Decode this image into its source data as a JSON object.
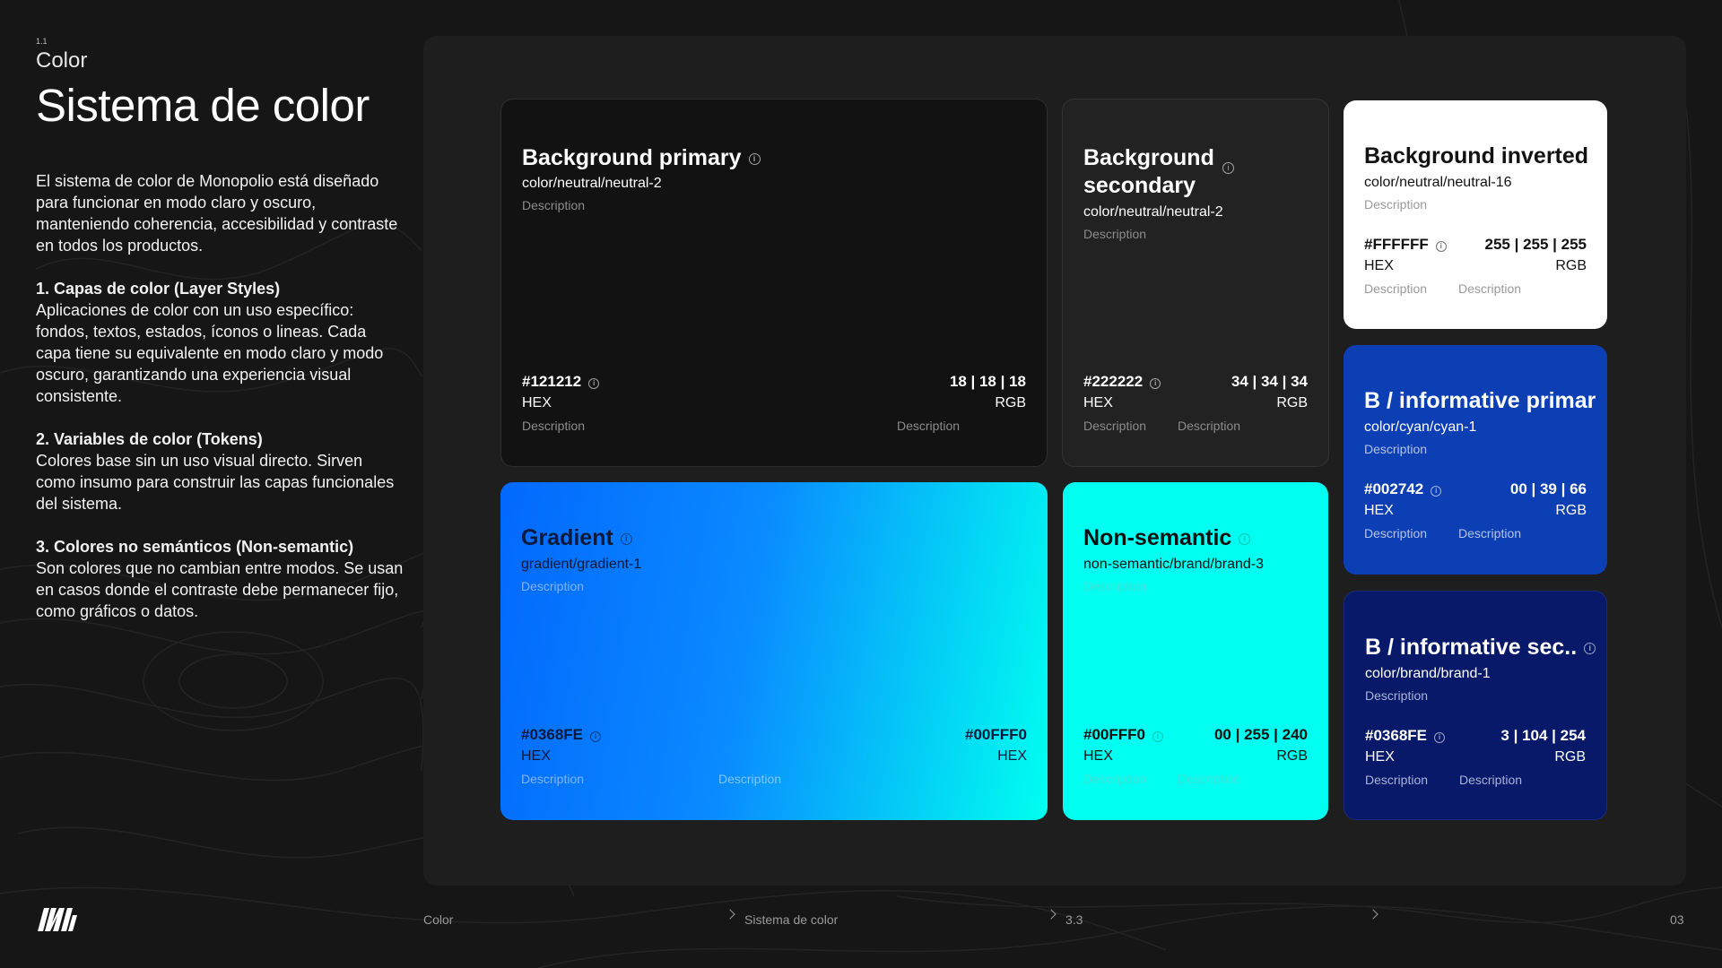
{
  "header": {
    "section_number": "1.1",
    "section_label": "Color",
    "title": "Sistema de color"
  },
  "intro": {
    "paragraph": "El sistema de color de Monopolio está diseñado para funcionar en modo claro y oscuro, manteniendo coherencia, accesibilidad y contraste en todos los productos.",
    "items": [
      {
        "heading": "1. Capas de color (Layer Styles)",
        "text": "Aplicaciones de color con un uso específico: fondos, textos, estados, íconos o lineas. Cada capa tiene su equivalente en modo claro y modo oscuro, garantizando una experiencia visual consistente."
      },
      {
        "heading": "2. Variables de color (Tokens)",
        "text": "Colores base sin un uso visual directo. Sirven como insumo para construir las capas funcionales del sistema."
      },
      {
        "heading": "3. Colores no semánticos (Non-semantic)",
        "text": "Son colores que no cambian entre modos. Se usan en casos donde el contraste debe permanecer fijo, como gráficos o datos."
      }
    ]
  },
  "cards": {
    "primary": {
      "title": "Background  primary",
      "token": "color/neutral/neutral-2",
      "description": "Description",
      "hex": "#121212",
      "rgb": "18 | 18 | 18",
      "hex_label": "HEX",
      "rgb_label": "RGB",
      "desc_left": "Description",
      "desc_right": "Description",
      "color": "#121212"
    },
    "secondary": {
      "title_line1": "Background",
      "title_line2": "secondary",
      "token": "color/neutral/neutral-2",
      "description": "Description",
      "hex": "#222222",
      "rgb": "34 | 34 | 34",
      "hex_label": "HEX",
      "rgb_label": "RGB",
      "desc_left": "Description",
      "desc_right": "Description",
      "color": "#222222"
    },
    "inverted": {
      "title": "Background  inverted",
      "token": "color/neutral/neutral-16",
      "description": "Description",
      "hex": "#FFFFFF",
      "rgb": "255 | 255 | 255",
      "hex_label": "HEX",
      "rgb_label": "RGB",
      "desc_left": "Description",
      "desc_right": "Description",
      "color": "#FFFFFF"
    },
    "informative_primary": {
      "title": "B / informative primar",
      "token": "color/cyan/cyan-1",
      "description": "Description",
      "hex": "#002742",
      "rgb": "00 | 39 | 66",
      "hex_label": "HEX",
      "rgb_label": "RGB",
      "desc_left": "Description",
      "desc_right": "Description",
      "color": "#0c3fb4"
    },
    "informative_secondary": {
      "title": "B / informative sec..",
      "token": "color/brand/brand-1",
      "description": "Description",
      "hex": "#0368FE",
      "rgb": "3 | 104 | 254",
      "hex_label": "HEX",
      "rgb_label": "RGB",
      "desc_left": "Description",
      "desc_right": "Description",
      "color": "#08196a"
    },
    "gradient": {
      "title": "Gradient",
      "token": "gradient/gradient-1",
      "description": "Description",
      "hex_start": "#0368FE",
      "hex_end": "#00FFF0",
      "label_left": "HEX",
      "label_right": "HEX",
      "desc_left": "Description",
      "desc_mid": "Description"
    },
    "non_semantic": {
      "title": "Non-semantic",
      "token": "non-semantic/brand/brand-3",
      "description": "Description",
      "hex": "#00FFF0",
      "rgb": "00 | 255 | 240",
      "hex_label": "HEX",
      "rgb_label": "RGB",
      "desc_left": "Description",
      "desc_right": "Description",
      "color": "#00FFF0"
    }
  },
  "footer": {
    "crumb_1": "Color",
    "crumb_2": "Sistema de color",
    "crumb_3": "3.3",
    "page_number": "03"
  }
}
